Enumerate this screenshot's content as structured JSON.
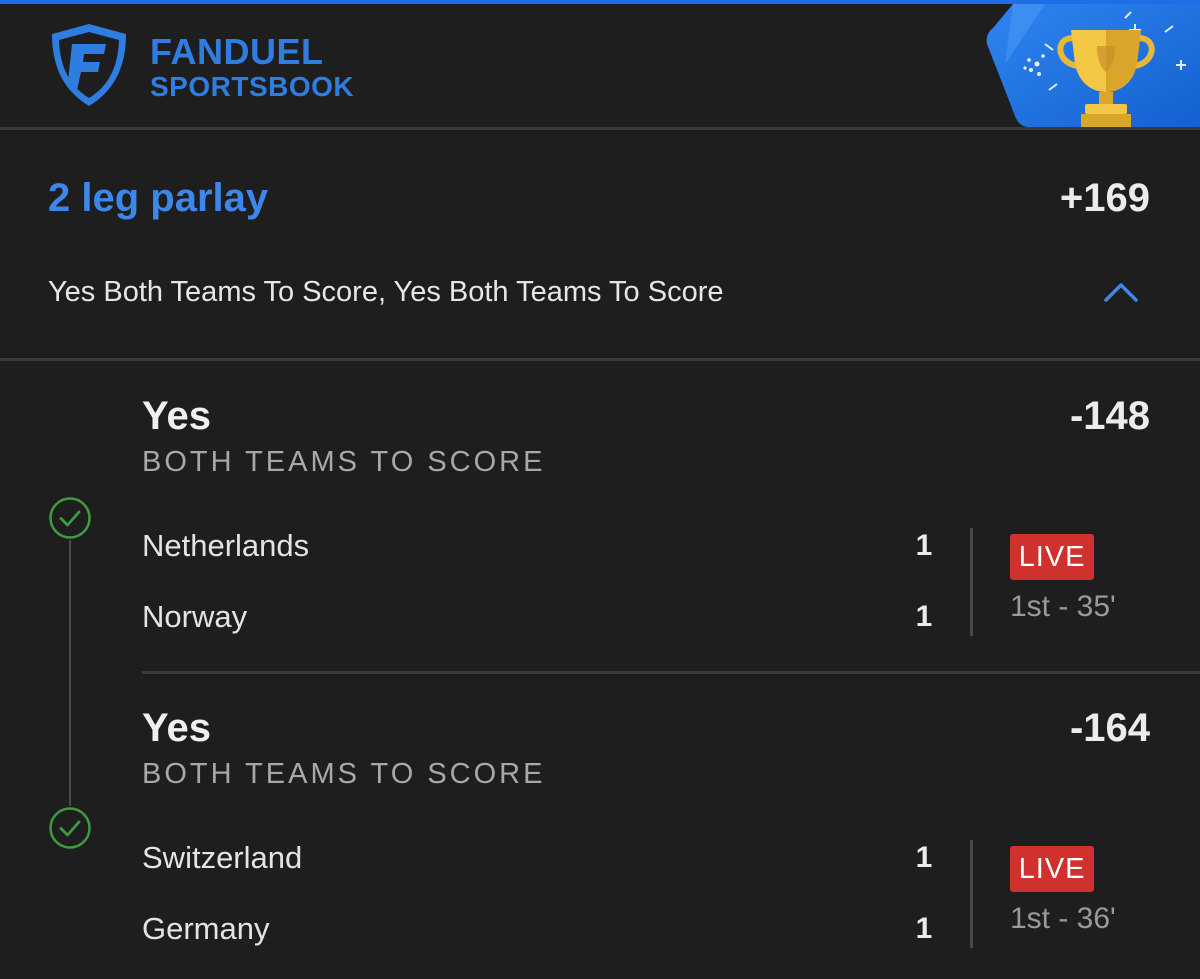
{
  "header": {
    "brand_name": "FANDUEL",
    "brand_sub": "SPORTSBOOK",
    "logo_icon": "fanduel-shield-icon",
    "badge_icon": "trophy-icon",
    "accent_color": "#2f7de1"
  },
  "parlay": {
    "title": "2 leg parlay",
    "odds": "+169",
    "legs_summary": "Yes Both Teams To Score, Yes Both Teams To Score",
    "toggle_icon": "chevron-up-icon"
  },
  "legs": [
    {
      "pick": "Yes",
      "market": "BOTH TEAMS TO SCORE",
      "odds": "-148",
      "status_icon": "check-circle-icon",
      "teams": [
        {
          "name": "Netherlands",
          "score": "1"
        },
        {
          "name": "Norway",
          "score": "1"
        }
      ],
      "live_label": "LIVE",
      "clock": "1st - 35'"
    },
    {
      "pick": "Yes",
      "market": "BOTH TEAMS TO SCORE",
      "odds": "-164",
      "status_icon": "check-circle-icon",
      "teams": [
        {
          "name": "Switzerland",
          "score": "1"
        },
        {
          "name": "Germany",
          "score": "1"
        }
      ],
      "live_label": "LIVE",
      "clock": "1st - 36'"
    }
  ],
  "colors": {
    "background": "#1e1e1f",
    "parlay_title": "#3d86ea",
    "live": "#d0312e",
    "check": "#3f9b3f"
  }
}
